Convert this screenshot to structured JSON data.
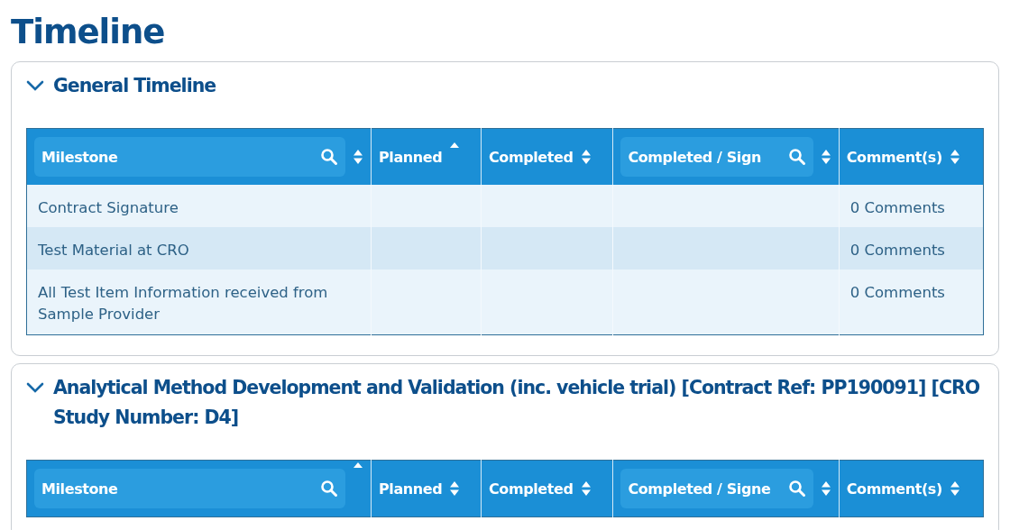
{
  "page": {
    "title": "Timeline"
  },
  "sections": [
    {
      "title": "General Timeline",
      "expanded": true,
      "columns": [
        {
          "kind": "search",
          "placeholder": "Milestone",
          "sorted_ascending": false
        },
        {
          "kind": "plain",
          "label": "Planned",
          "sorted_ascending": true
        },
        {
          "kind": "plain",
          "label": "Completed",
          "sorted_ascending": false
        },
        {
          "kind": "search",
          "placeholder": "Completed / Sign",
          "sorted_ascending": false
        },
        {
          "kind": "plain",
          "label": "Comment(s)",
          "sorted_ascending": false
        }
      ],
      "rows": [
        {
          "milestone": "Contract Signature",
          "comments": "0 Comments"
        },
        {
          "milestone": "Test Material at CRO",
          "comments": "0 Comments"
        },
        {
          "milestone": "All Test Item Information received from Sample Provider",
          "comments": "0 Comments"
        }
      ]
    },
    {
      "title": "Analytical Method Development and Validation (inc. vehicle trial) [Contract Ref: PP190091] [CRO Study Number: D4]",
      "expanded": true,
      "columns": [
        {
          "kind": "search",
          "placeholder": "Milestone",
          "sorted_ascending": true
        },
        {
          "kind": "plain",
          "label": "Planned",
          "sorted_ascending": false
        },
        {
          "kind": "plain",
          "label": "Completed",
          "sorted_ascending": false
        },
        {
          "kind": "search",
          "placeholder": "Completed / Signe",
          "sorted_ascending": false
        },
        {
          "kind": "plain",
          "label": "Comment(s)",
          "sorted_ascending": false
        }
      ]
    }
  ]
}
